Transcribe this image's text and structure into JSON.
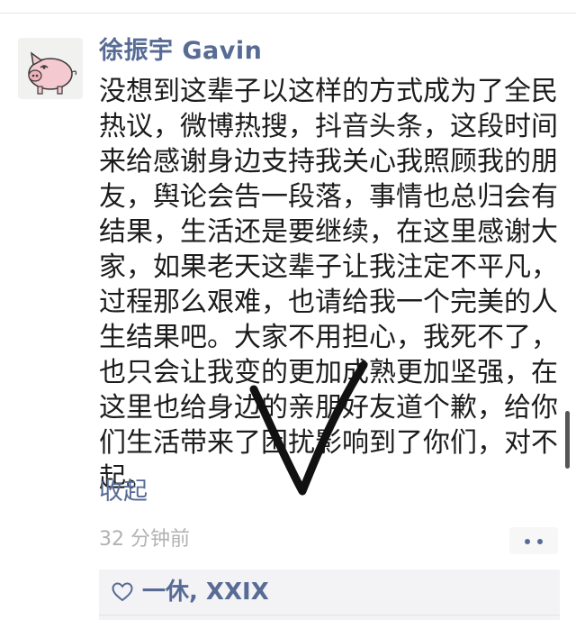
{
  "post": {
    "author_name": "徐振宇 Gavin",
    "avatar_icon": "cartoon-pig-icon",
    "lines": [
      "没想到这辈子以这样的方式成为了全民",
      "热议，微博热搜，抖音头条，这段时间",
      "来给感谢身边支持我关心我照顾我的朋",
      "友，舆论会告一段落，事情也总归会有",
      "结果，生活还是要继续，在这里感谢大",
      "家，如果老天这辈子让我注定不平凡，",
      "过程那么艰难，也请给我一个完美的人",
      "生结果吧。大家不用担心，我死不了，",
      "也只会让我变的更加成熟更加坚强，在",
      "这里也给身边的亲朋好友道个歉，给你",
      "们生活带来了困扰影响到了你们，对不",
      "起。"
    ],
    "collapse_label": "收起",
    "timestamp": "32 分钟前"
  },
  "likes": {
    "icon": "heart-outline-icon",
    "names": "一休, XXIX"
  },
  "colors": {
    "link_blue": "#576b95",
    "text": "#1c1c1c",
    "timestamp_gray": "#b2b2b2",
    "likes_bg": "#f3f3f5"
  }
}
